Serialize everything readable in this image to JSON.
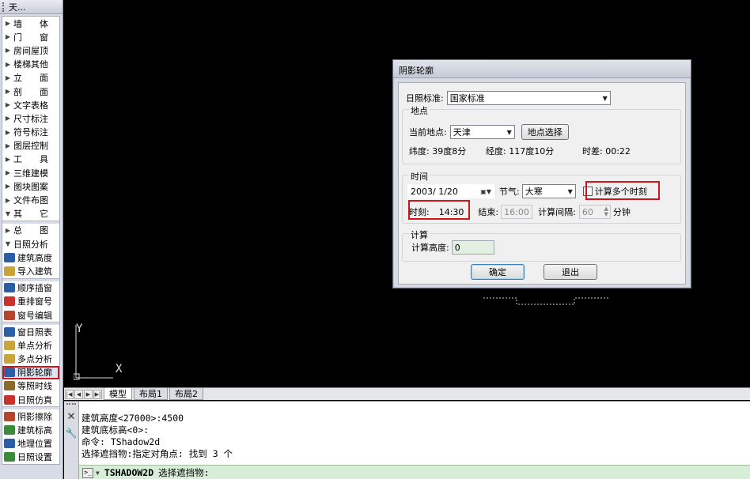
{
  "palette": {
    "title": "天...",
    "top_items": [
      {
        "label": "墙　　体",
        "arrow": "▶"
      },
      {
        "label": "门　　窗",
        "arrow": "▶"
      },
      {
        "label": "房间屋顶",
        "arrow": "▶"
      },
      {
        "label": "楼梯其他",
        "arrow": "▶"
      },
      {
        "label": "立　　面",
        "arrow": "▶"
      },
      {
        "label": "剖　　面",
        "arrow": "▶"
      },
      {
        "label": "文字表格",
        "arrow": "▶"
      },
      {
        "label": "尺寸标注",
        "arrow": "▶"
      },
      {
        "label": "符号标注",
        "arrow": "▶"
      },
      {
        "label": "图层控制",
        "arrow": "▶"
      },
      {
        "label": "工　　具",
        "arrow": "▶"
      },
      {
        "label": "三维建模",
        "arrow": "▶"
      },
      {
        "label": "图块图案",
        "arrow": "▶"
      },
      {
        "label": "文件布图",
        "arrow": "▶"
      },
      {
        "label": "其　　它",
        "arrow": "▼"
      }
    ],
    "mid_items": [
      {
        "label": "总　　图",
        "arrow": "▶"
      },
      {
        "label": "日照分析",
        "arrow": "▼"
      }
    ],
    "tools_a": [
      {
        "label": "建筑高度",
        "icon": "building-height-icon",
        "color": "#2a5fa8"
      },
      {
        "label": "导入建筑",
        "icon": "import-building-icon",
        "color": "#c9a43a"
      }
    ],
    "tools_b": [
      {
        "label": "顺序插窗",
        "icon": "sequential-window-icon",
        "color": "#2a5fa8"
      },
      {
        "label": "重排窗号",
        "icon": "renumber-window-icon",
        "color": "#c8322d"
      },
      {
        "label": "窗号编辑",
        "icon": "edit-window-number-icon",
        "color": "#b5452d"
      }
    ],
    "tools_c": [
      {
        "label": "窗日照表",
        "icon": "window-sunlight-table-icon",
        "color": "#2a5fa8"
      },
      {
        "label": "单点分析",
        "icon": "single-point-analysis-icon",
        "color": "#c9a43a"
      },
      {
        "label": "多点分析",
        "icon": "multi-point-analysis-icon",
        "color": "#c9a43a"
      },
      {
        "label": "阴影轮廓",
        "icon": "shadow-outline-icon",
        "color": "#2a5fa8"
      },
      {
        "label": "等照时线",
        "icon": "isochrone-icon",
        "color": "#8a6a2a"
      },
      {
        "label": "日照仿真",
        "icon": "sunlight-simulation-icon",
        "color": "#c8322d"
      }
    ],
    "tools_d": [
      {
        "label": "阴影擦除",
        "icon": "shadow-erase-icon",
        "color": "#b5452d"
      },
      {
        "label": "建筑标高",
        "icon": "building-elevation-icon",
        "color": "#3b8a3b"
      },
      {
        "label": "地理位置",
        "icon": "geo-location-icon",
        "color": "#2a5fa8"
      },
      {
        "label": "日照设置",
        "icon": "sunlight-settings-icon",
        "color": "#3b8a3b"
      }
    ]
  },
  "dialog": {
    "title": "阴影轮廓",
    "sun_standard_label": "日照标准:",
    "sun_standard_value": "国家标准",
    "location_group": "地点",
    "current_location_label": "当前地点:",
    "current_location_value": "天津",
    "pick_location_button": "地点选择",
    "latitude": "纬度: 39度8分",
    "longitude": "经度: 117度10分",
    "time_diff": "时差:  00:22",
    "time_group": "时间",
    "date_value": "2003/ 1/20",
    "solar_term_label": "节气:",
    "solar_term_value": "大寒",
    "multi_time_label": "计算多个时刻",
    "time_label": "时刻:",
    "time_value": "14:30",
    "end_label": "结束:",
    "end_value": "16:00",
    "interval_label": "计算间隔:",
    "interval_value": "60",
    "interval_unit": "分钟",
    "calc_group": "计算",
    "calc_height_label": "计算高度:",
    "calc_height_value": "0",
    "ok_button": "确定",
    "exit_button": "退出"
  },
  "ucs": {
    "y": "Y",
    "x": "X"
  },
  "tabs": {
    "model": "模型",
    "layout1": "布局1",
    "layout2": "布局2"
  },
  "command": {
    "lines": [
      "建筑高度<27000>:4500",
      "建筑底标高<0>:",
      "命令: TShadow2d",
      "选择遮挡物:指定对角点: 找到 3 个"
    ],
    "prompt_command": "TSHADOW2D",
    "prompt_text": "选择遮挡物:"
  },
  "colors": {
    "highlight": "#d0141e",
    "command_input_bg": "#d8edd8"
  }
}
